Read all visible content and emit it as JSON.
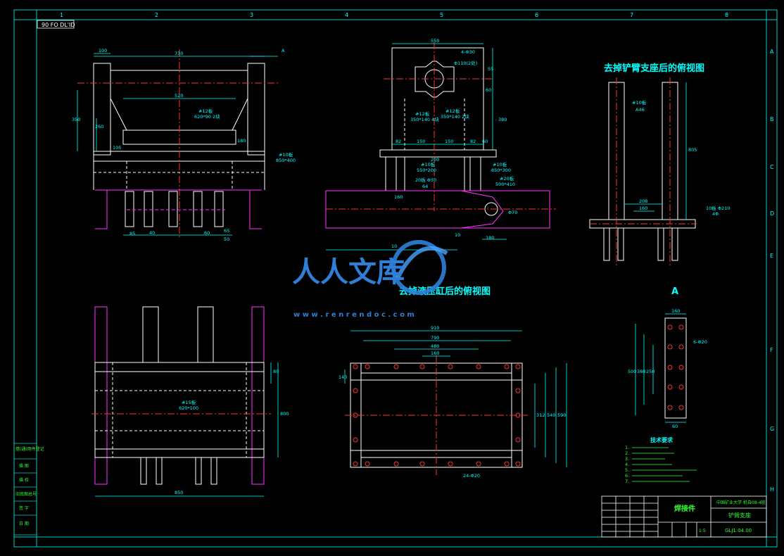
{
  "sheet": {
    "stamp": "90 FO DL'ID",
    "columns": [
      "1",
      "2",
      "3",
      "4",
      "5",
      "6",
      "7",
      "8"
    ],
    "rows": [
      "A",
      "B",
      "C",
      "D",
      "E",
      "F",
      "G",
      "H"
    ]
  },
  "view_titles": {
    "top_view_without_arm": "去掉铲臂支座后的俯视图",
    "top_view_without_cylinder": "去掉液压缸后的俯视图",
    "detail_a": "A"
  },
  "watermark": {
    "brand": "人人文库",
    "url": "w w w . r e n r e n d o c . c o m"
  },
  "dims": {
    "front": [
      "100",
      "730",
      "520",
      "350",
      "260",
      "105",
      "180",
      "A",
      "#12板",
      "620*90 2块",
      "#10板",
      "850*400",
      "85",
      "65",
      "60",
      "40",
      "50"
    ],
    "side": [
      "550",
      "4-Φ30",
      "Φ110(2处)",
      "55",
      "#12板",
      "350*140 4块",
      "#12板",
      "350*140 2块",
      "380",
      "60",
      "#10板",
      "550*200",
      "#10板",
      "850*300",
      "82",
      "150",
      "150",
      "82",
      "60",
      "200",
      "20板 Φ50",
      "64",
      "#20板",
      "500*410",
      "Φ70",
      "160",
      "180",
      "10",
      "10"
    ],
    "top_right": [
      "#10板",
      "A46",
      "805",
      "208",
      "160",
      "10板 Φ210",
      "4Φ"
    ],
    "bottom_left": [
      "#15板",
      "620*100",
      "850",
      "80",
      "800"
    ],
    "bottom_mid": [
      "910",
      "790",
      "480",
      "160",
      "140",
      "312",
      "540",
      "590",
      "24-Φ20"
    ],
    "detail": [
      "160",
      "6-Φ20",
      "500",
      "380",
      "250",
      "60"
    ]
  },
  "notes": {
    "title": "技术要求",
    "lines": [
      "1.",
      "2.",
      "3.",
      "4.",
      "5.",
      "6.",
      "7."
    ]
  },
  "left_labels": [
    "借(通)用件登记",
    "描 图",
    "描 校",
    "旧底图总号",
    "签 字",
    "日 期"
  ],
  "title_block": {
    "part_type": "焊接件",
    "school": "中国矿业大学 机自08-4班",
    "part_name": "铲臂支座",
    "drawing_no": "GLJ1.04.00",
    "scale": "1:5"
  }
}
